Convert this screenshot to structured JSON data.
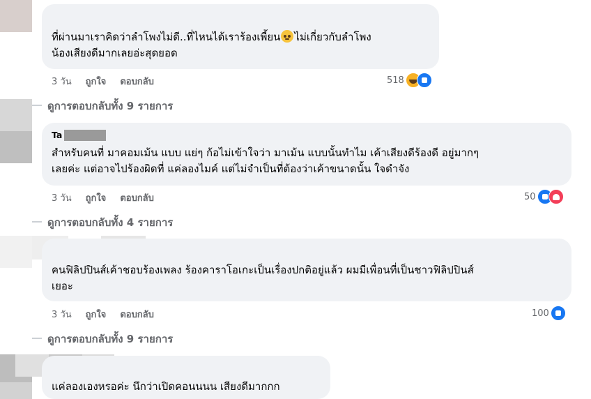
{
  "comments": [
    {
      "text_lines": [
        "ที่ผ่านมาเราคิดว่าลำโพงไม่ดี..ที่ไหนได้เราร้องเพี้ยน",
        "น้องเสียงดีมากเลยอ่ะสุดยอด"
      ],
      "text_after_emoji": "ไม่เกี่ยวกับลำโพง",
      "inline_emoji": "anxious-face-emoji",
      "time": "3 วัน",
      "like_label": "ถูกใจ",
      "reply_label": "ตอบกลับ",
      "reaction_count": "518",
      "reactions": [
        "haha-reaction-icon",
        "like-reaction-icon"
      ],
      "view_replies": "ดูการตอบกลับทั้ง 9 รายการ"
    },
    {
      "name": "Ta",
      "text_lines": [
        "สำหรับคนที่ มาคอมเม้น แบบ แย่ๆ ก้อไม่เข้าใจว่า มาเม้น แบบนั้นทำไม เค้าเสียงดีร้องดี อยู่มากๆ",
        "เลยค่ะ แต่อาจไปร้องผิดที่ แค่ลองไมค์ แต่ไม่จำเป็นที่ต้องว่าเค้าขนาดนั้น ใจดำจัง"
      ],
      "time": "3 วัน",
      "like_label": "ถูกใจ",
      "reply_label": "ตอบกลับ",
      "reaction_count": "50",
      "reactions": [
        "like-reaction-icon",
        "love-reaction-icon"
      ],
      "view_replies": "ดูการตอบกลับทั้ง 4 รายการ"
    },
    {
      "text_lines": [
        "คนฟิลิปปินส์เค้าชอบร้องเพลง ร้องคาราโอเกะเป็นเรื่องปกติอยู่แล้ว ผมมีเพื่อนที่เป็นชาวฟิลิปปินส์",
        "เยอะ"
      ],
      "time": "3 วัน",
      "like_label": "ถูกใจ",
      "reply_label": "ตอบกลับ",
      "reaction_count": "100",
      "reactions": [
        "like-reaction-icon"
      ],
      "view_replies": "ดูการตอบกลับทั้ง 9 รายการ"
    },
    {
      "text_lines": [
        "แค่ลองเองหรอค่ะ นึกว่าเปิดคอนนนน เสียงดีมากกก"
      ]
    }
  ],
  "colors": {
    "bubble": "#f0f2f5",
    "meta": "#65676b",
    "like": "#1877f2",
    "love": "#f33e58",
    "haha": "#f7b125"
  }
}
